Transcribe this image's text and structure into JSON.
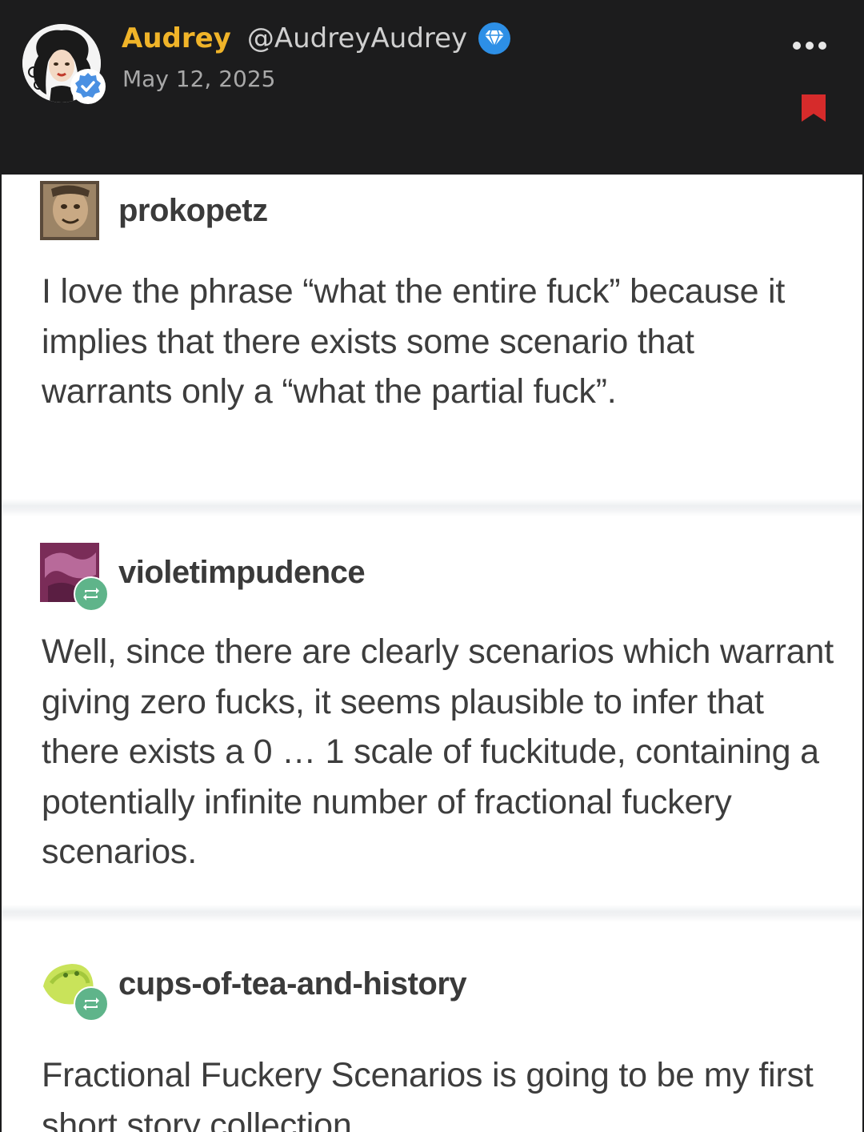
{
  "post": {
    "author_name": "Audrey",
    "author_handle": "@AudreyAudrey",
    "date": "May 12, 2025",
    "icons": {
      "avatar": "avatar-illustration",
      "verified": "verified-check-icon",
      "premium": "diamond-icon",
      "more": "more-options-icon",
      "bookmark": "bookmark-icon"
    },
    "colors": {
      "header_bg": "#1c1c1d",
      "name": "#f0b429",
      "bookmark": "#d62b2b",
      "premium_badge": "#2d8fe6"
    }
  },
  "thread": [
    {
      "username": "prokopetz",
      "text": "I love the phrase “what the entire fuck” because it implies that there exists some scenario that warrants only a “what the partial fuck”."
    },
    {
      "username": "violetimpudence",
      "text": "Well, since there are clearly scenarios which warrant giving zero fucks, it seems plausible to infer that there exists a 0 … 1 scale of fuckitude, containing a potentially infinite number of fractional fuckery scenarios."
    },
    {
      "username": "cups-of-tea-and-history",
      "text": "Fractional Fuckery Scenarios is going to be my first short story collection."
    }
  ]
}
